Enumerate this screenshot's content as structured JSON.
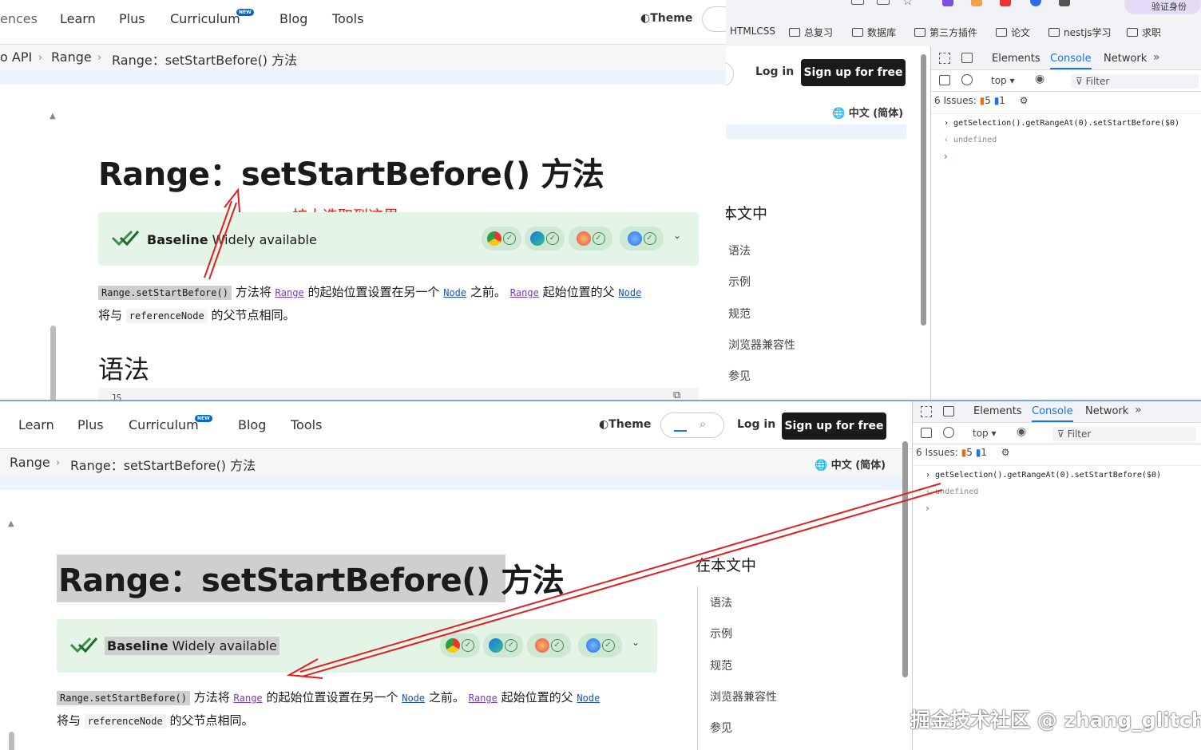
{
  "top_window": {
    "nav": {
      "partial_item": "ences",
      "items": [
        "Learn",
        "Plus",
        "Curriculum",
        "Blog",
        "Tools"
      ],
      "new_badge": "NEW",
      "theme": "Theme"
    },
    "breadcrumb": {
      "items": [
        "o API",
        "Range",
        "Range：setStartBefore() 方法"
      ]
    },
    "page_title": "Range：setStartBefore() 方法",
    "annotation": "扩大选取到这里",
    "baseline": {
      "label": "Baseline",
      "label_rest": " Widely available"
    },
    "desc": {
      "code_method": "Range.setStartBefore()",
      "t1": "方法将",
      "link_range": "Range",
      "t2": "的起始位置设置在另一个",
      "link_node": "Node",
      "t3": "之前。",
      "link_range2": "Range",
      "t4": "起始位置的父",
      "link_node2": "Node",
      "t5": "将与",
      "code_ref": "referenceNode",
      "t6": "的父节点相同。"
    },
    "section_title": "语法",
    "code_lang": "JS"
  },
  "browser": {
    "bookmarks": [
      "HTMLCSS",
      "总复习",
      "数据库",
      "第三方插件",
      "论文",
      "nestjs学习",
      "求职"
    ],
    "verify_label": "验证身份"
  },
  "middle_panel": {
    "login": "Log in",
    "signup": "Sign up for free",
    "lang": "中文 (简体)",
    "toc_title": "在本文中",
    "toc_partial_title": "本文中",
    "toc": [
      "语法",
      "示例",
      "规范",
      "浏览器兼容性",
      "参见"
    ]
  },
  "devtools_top": {
    "tabs": [
      "Elements",
      "Console",
      "Network"
    ],
    "context": "top",
    "filter_placeholder": "Filter",
    "issues_label": "6 Issues:",
    "issues_warn": "5",
    "issues_info": "1",
    "console_input": "getSelection().getRangeAt(0).setStartBefore($0)",
    "console_result": "undefined"
  },
  "bottom_window": {
    "nav": {
      "items": [
        "Learn",
        "Plus",
        "Curriculum",
        "Blog",
        "Tools"
      ],
      "new_badge": "NEW",
      "theme": "Theme",
      "login": "Log in",
      "signup": "Sign up for free"
    },
    "breadcrumb": {
      "items": [
        "Range",
        "Range：setStartBefore() 方法"
      ]
    },
    "lang": "中文 (简体)",
    "page_title": "Range：setStartBefore() 方法",
    "baseline": {
      "label": "Baseline",
      "label_rest": " Widely available"
    },
    "toc_title": "在本文中",
    "toc": [
      "语法",
      "示例",
      "规范",
      "浏览器兼容性",
      "参见"
    ]
  },
  "devtools_bottom": {
    "tabs": [
      "Elements",
      "Console",
      "Network"
    ],
    "context": "top",
    "filter_placeholder": "Filter",
    "issues_label": "6 Issues:",
    "issues_warn": "5",
    "issues_info": "1",
    "console_input": "getSelection().getRangeAt(0).setStartBefore($0)",
    "console_result": "undefined"
  },
  "watermark": "掘金技术社区 @ zhang_glitch",
  "colors": {
    "accent_blue": "#1a73e8",
    "annotation_red": "#e02020",
    "baseline_green": "#e4f4e6",
    "selection_gray": "#cfcfcf"
  }
}
